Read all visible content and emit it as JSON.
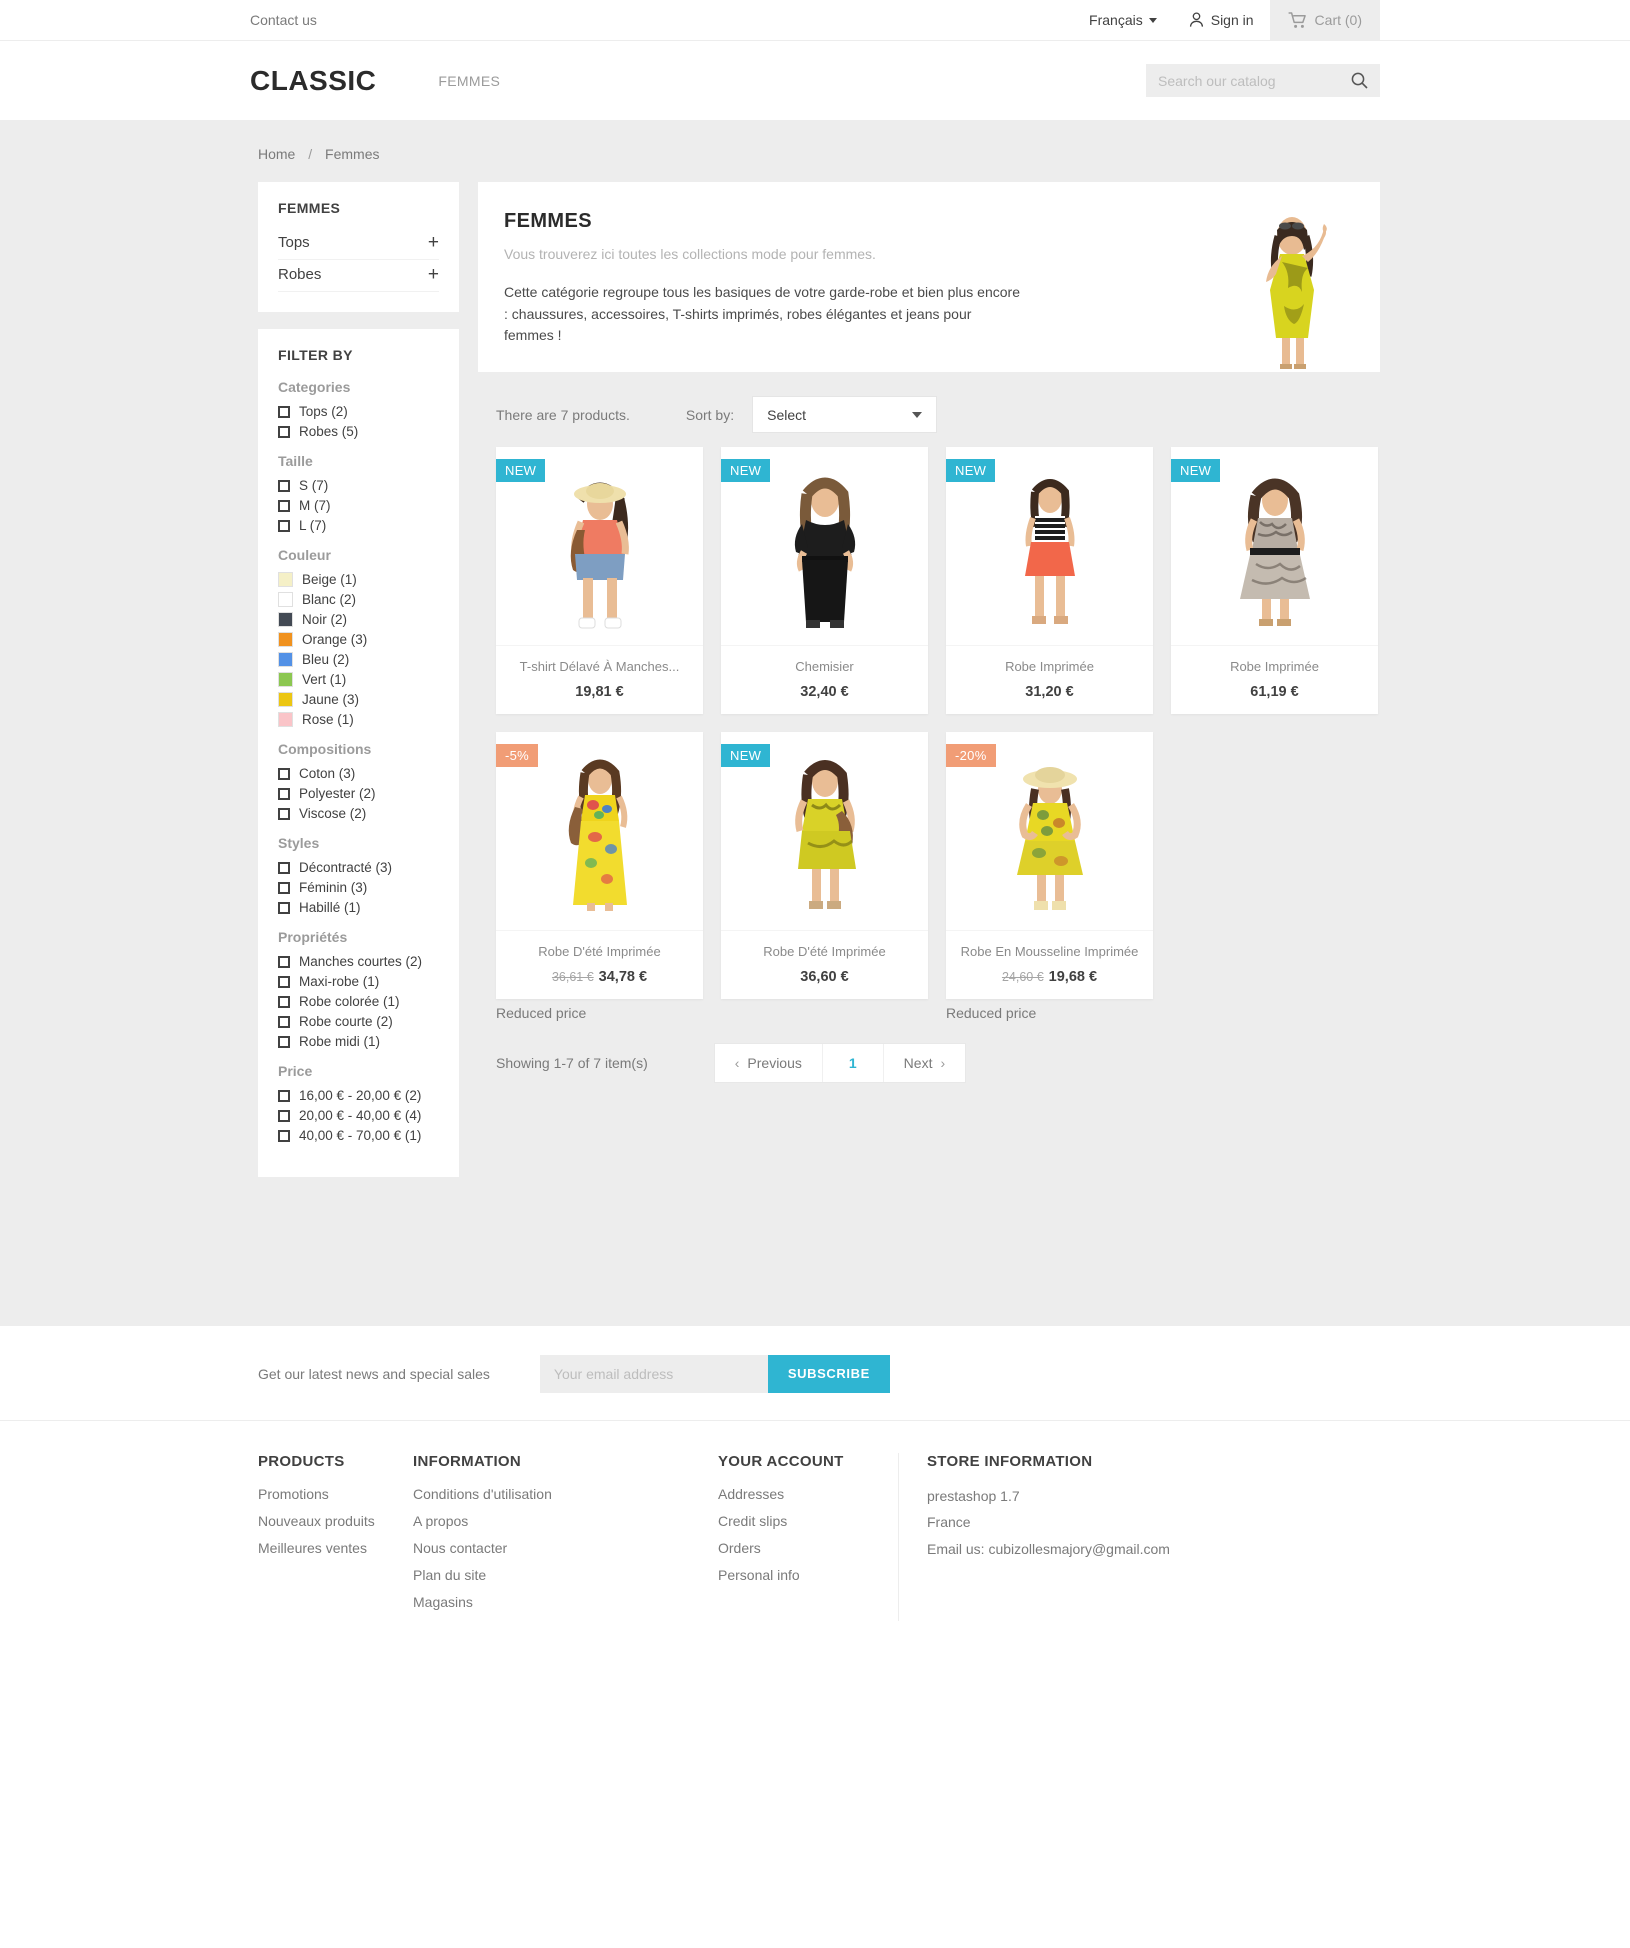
{
  "topnav": {
    "contact_label": "Contact us",
    "language": "Français",
    "signin_label": "Sign in",
    "cart_label": "Cart (0)"
  },
  "header": {
    "logo": "CLASSIC",
    "menu": [
      {
        "label": "FEMMES"
      }
    ],
    "search_placeholder": "Search our catalog",
    "search_value": ""
  },
  "breadcrumb": {
    "home": "Home",
    "separator": "/",
    "current": "Femmes"
  },
  "sidebar": {
    "category_block": {
      "title": "FEMMES",
      "items": [
        {
          "label": "Tops",
          "expand": "+"
        },
        {
          "label": "Robes",
          "expand": "+"
        }
      ]
    },
    "filter_title": "FILTER BY",
    "groups": [
      {
        "name": "Categories",
        "type": "checkbox",
        "items": [
          {
            "label": "Tops (2)"
          },
          {
            "label": "Robes (5)"
          }
        ]
      },
      {
        "name": "Taille",
        "type": "checkbox",
        "items": [
          {
            "label": "S (7)"
          },
          {
            "label": "M (7)"
          },
          {
            "label": "L (7)"
          }
        ]
      },
      {
        "name": "Couleur",
        "type": "swatch",
        "items": [
          {
            "label": "Beige (1)",
            "color": "#f5f0c7"
          },
          {
            "label": "Blanc (2)",
            "color": "#ffffff"
          },
          {
            "label": "Noir (2)",
            "color": "#434a54"
          },
          {
            "label": "Orange (3)",
            "color": "#f0921f"
          },
          {
            "label": "Bleu (2)",
            "color": "#5391e6"
          },
          {
            "label": "Vert (1)",
            "color": "#8cc751"
          },
          {
            "label": "Jaune (3)",
            "color": "#ecc613"
          },
          {
            "label": "Rose (1)",
            "color": "#fac4c8"
          }
        ]
      },
      {
        "name": "Compositions",
        "type": "checkbox",
        "items": [
          {
            "label": "Coton (3)"
          },
          {
            "label": "Polyester (2)"
          },
          {
            "label": "Viscose (2)"
          }
        ]
      },
      {
        "name": "Styles",
        "type": "checkbox",
        "items": [
          {
            "label": "Décontracté (3)"
          },
          {
            "label": "Féminin (3)"
          },
          {
            "label": "Habillé (1)"
          }
        ]
      },
      {
        "name": "Propriétés",
        "type": "checkbox",
        "items": [
          {
            "label": "Manches courtes (2)"
          },
          {
            "label": "Maxi-robe (1)"
          },
          {
            "label": "Robe colorée (1)"
          },
          {
            "label": "Robe courte (2)"
          },
          {
            "label": "Robe midi (1)"
          }
        ]
      },
      {
        "name": "Price",
        "type": "checkbox",
        "items": [
          {
            "label": "16,00 € - 20,00 € (2)"
          },
          {
            "label": "20,00 € - 40,00 € (4)"
          },
          {
            "label": "40,00 € - 70,00 € (1)"
          }
        ]
      }
    ]
  },
  "hero": {
    "title": "FEMMES",
    "subtitle": "Vous trouverez ici toutes les collections mode pour femmes.",
    "description": "Cette catégorie regroupe tous les basiques de votre garde-robe et bien plus encore : chaussures, accessoires, T-shirts imprimés, robes élégantes et jeans pour femmes !"
  },
  "toolbar": {
    "product_count": "There are 7 products.",
    "sort_label": "Sort by:",
    "sort_value": "Select"
  },
  "products": [
    {
      "name": "T-shirt Délavé À Manches...",
      "price": "19,81 €",
      "old_price": "",
      "badge": "NEW",
      "badge_type": "new",
      "reduced_note": "",
      "img": "woman-orange-top"
    },
    {
      "name": "Chemisier",
      "price": "32,40 €",
      "old_price": "",
      "badge": "NEW",
      "badge_type": "new",
      "reduced_note": "",
      "img": "woman-black-blouse"
    },
    {
      "name": "Robe Imprimée",
      "price": "31,20 €",
      "old_price": "",
      "badge": "NEW",
      "badge_type": "new",
      "reduced_note": "",
      "img": "woman-orange-skirt"
    },
    {
      "name": "Robe Imprimée",
      "price": "61,19 €",
      "old_price": "",
      "badge": "NEW",
      "badge_type": "new",
      "reduced_note": "",
      "img": "woman-grey-dress"
    },
    {
      "name": "Robe D'été Imprimée",
      "price": "34,78 €",
      "old_price": "36,61 €",
      "badge": "-5%",
      "badge_type": "disc",
      "reduced_note": "Reduced price",
      "img": "woman-yellow-maxi"
    },
    {
      "name": "Robe D'été Imprimée",
      "price": "36,60 €",
      "old_price": "",
      "badge": "NEW",
      "badge_type": "new",
      "reduced_note": "",
      "img": "woman-yellow-short"
    },
    {
      "name": "Robe En Mousseline Imprimée",
      "price": "19,68 €",
      "old_price": "24,60 €",
      "badge": "-20%",
      "badge_type": "disc",
      "reduced_note": "Reduced price",
      "img": "woman-yellow-hat"
    }
  ],
  "pagination": {
    "showing": "Showing 1-7 of 7 item(s)",
    "previous": "Previous",
    "page": "1",
    "next": "Next"
  },
  "newsletter": {
    "text": "Get our latest news and special sales",
    "placeholder": "Your email address",
    "value": "",
    "button": "Subscribe"
  },
  "footer": {
    "products": {
      "title": "PRODUCTS",
      "links": [
        {
          "label": "Promotions"
        },
        {
          "label": "Nouveaux produits"
        },
        {
          "label": "Meilleures ventes"
        }
      ]
    },
    "information": {
      "title": "INFORMATION",
      "links": [
        {
          "label": "Conditions d'utilisation"
        },
        {
          "label": "A propos"
        },
        {
          "label": "Nous contacter"
        },
        {
          "label": "Plan du site"
        },
        {
          "label": "Magasins"
        }
      ]
    },
    "account": {
      "title": "YOUR ACCOUNT",
      "links": [
        {
          "label": "Addresses"
        },
        {
          "label": "Credit slips"
        },
        {
          "label": "Orders"
        },
        {
          "label": "Personal info"
        }
      ]
    },
    "store": {
      "title": "STORE INFORMATION",
      "lines": [
        {
          "text": "prestashop 1.7"
        },
        {
          "text": "France"
        },
        {
          "text": "Email us: cubizollesmajory@gmail.com"
        }
      ]
    }
  },
  "colors": {
    "accent": "#2fb5d2",
    "discount": "#f19d76",
    "body_bg": "#ededed"
  }
}
